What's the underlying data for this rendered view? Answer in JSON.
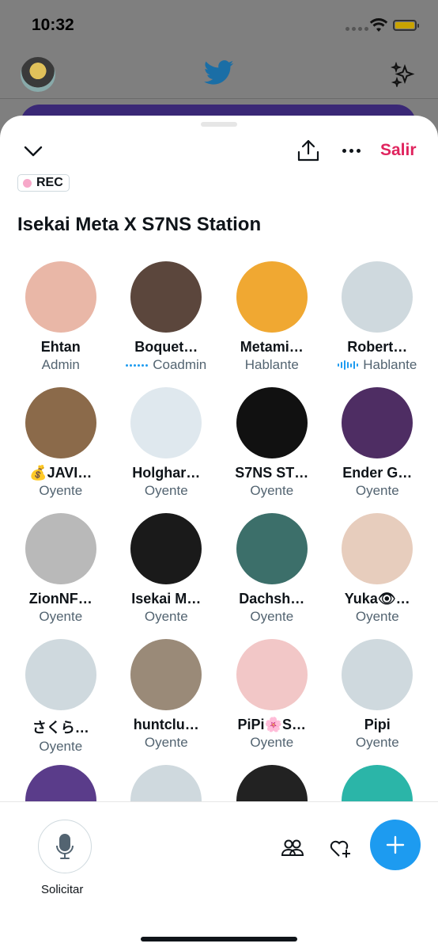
{
  "status_bar": {
    "time": "10:32"
  },
  "header": {
    "exit_label": "Salir"
  },
  "space": {
    "rec_label": "REC",
    "title": "Isekai Meta X S7NS Station"
  },
  "participants": [
    {
      "name": "Ehtan",
      "role": "Admin",
      "indicator": "",
      "avatar": "#e9b7a7"
    },
    {
      "name": "Boquet…",
      "role": "Coadmin",
      "indicator": "dots",
      "avatar": "#5b463c"
    },
    {
      "name": "Metami…",
      "role": "Hablante",
      "indicator": "",
      "avatar": "#f0a832"
    },
    {
      "name": "Robert…",
      "role": "Hablante",
      "indicator": "bars",
      "avatar": "#cfd9de"
    },
    {
      "name": "💰JAVI…",
      "role": "Oyente",
      "indicator": "",
      "avatar": "#8b6a4a"
    },
    {
      "name": "Holghar…",
      "role": "Oyente",
      "indicator": "",
      "avatar": "#dfe8ee"
    },
    {
      "name": "S7NS ST…",
      "role": "Oyente",
      "indicator": "",
      "avatar": "#111111"
    },
    {
      "name": "Ender G…",
      "role": "Oyente",
      "indicator": "",
      "avatar": "#4e2d63"
    },
    {
      "name": "ZionNF…",
      "role": "Oyente",
      "indicator": "",
      "avatar": "#b9b9b9"
    },
    {
      "name": "Isekai M…",
      "role": "Oyente",
      "indicator": "",
      "avatar": "#1a1a1a"
    },
    {
      "name": "Dachsh…",
      "role": "Oyente",
      "indicator": "",
      "avatar": "#3c6f6a"
    },
    {
      "name": "Yuka👁…",
      "role": "Oyente",
      "indicator": "",
      "avatar": "#e7cdbd"
    },
    {
      "name": "さくら…",
      "role": "Oyente",
      "indicator": "",
      "avatar": "#cfd9de"
    },
    {
      "name": "huntclu…",
      "role": "Oyente",
      "indicator": "",
      "avatar": "#9a8a78"
    },
    {
      "name": "PiPi🌸S…",
      "role": "Oyente",
      "indicator": "",
      "avatar": "#f2c7c7"
    },
    {
      "name": "Pipi",
      "role": "Oyente",
      "indicator": "",
      "avatar": "#cfd9de"
    },
    {
      "name": "",
      "role": "",
      "indicator": "",
      "avatar": "#5a3c8a"
    },
    {
      "name": "",
      "role": "",
      "indicator": "",
      "avatar": "#cfd9de"
    },
    {
      "name": "",
      "role": "",
      "indicator": "",
      "avatar": "#222222"
    },
    {
      "name": "",
      "role": "",
      "indicator": "",
      "avatar": "#2bb5a8"
    }
  ],
  "bottom_bar": {
    "request_label": "Solicitar"
  },
  "colors": {
    "accent": "#1d9bf0",
    "exit": "#e0245e",
    "muted": "#536471"
  }
}
